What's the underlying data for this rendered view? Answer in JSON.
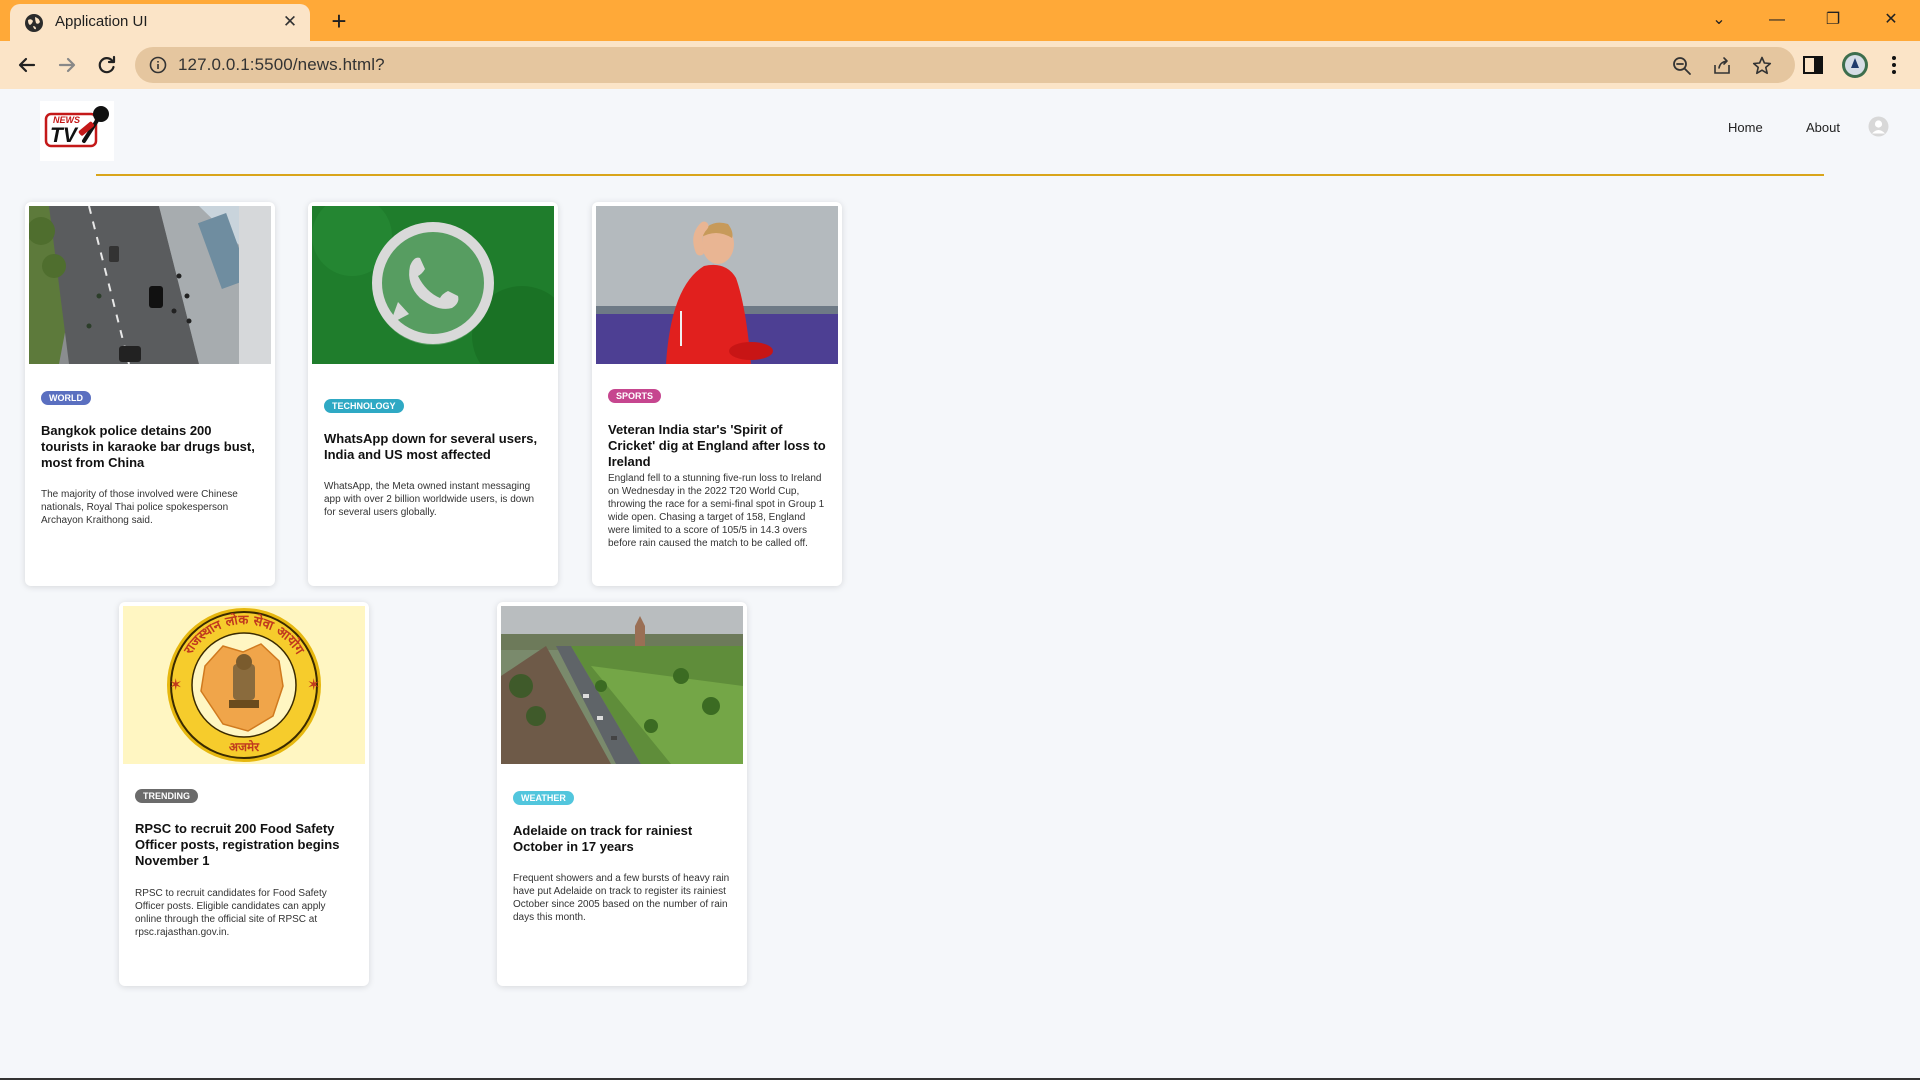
{
  "browser": {
    "tab_title": "Application UI",
    "url": "127.0.0.1:5500/news.html?",
    "accent_color": "#ffa938"
  },
  "header": {
    "logo_alt": "NEWS TV",
    "nav": [
      "Home",
      "About"
    ]
  },
  "articles": [
    {
      "category": "WORLD",
      "badge_color": "#5a6fc0",
      "title": "Bangkok police detains 200 tourists in karaoke bar drugs bust, most from China",
      "description": "The majority of those involved were Chinese nationals, Royal Thai police spokesperson Archayon Kraithong said.",
      "image": "street-scene-image"
    },
    {
      "category": "TECHNOLOGY",
      "badge_color": "#2fa9c4",
      "title": "WhatsApp down for several users, India and US most affected",
      "description": "WhatsApp, the Meta owned instant messaging app with over 2 billion worldwide users, is down for several users globally.",
      "image": "whatsapp-logo-image"
    },
    {
      "category": "SPORTS",
      "badge_color": "#c6468f",
      "title": "Veteran India star's 'Spirit of Cricket' dig at England after loss to Ireland",
      "description": "England fell to a stunning five-run loss to Ireland on Wednesday in the 2022 T20 World Cup, throwing the race for a semi-final spot in Group 1 wide open. Chasing a target of 158, England were limited to a score of 105/5 in 14.3 overs before rain caused the match to be called off.",
      "image": "cricketer-image"
    },
    {
      "category": "TRENDING",
      "badge_color": "#6b6b6b",
      "title": "RPSC to recruit 200 Food Safety Officer posts, registration begins November 1",
      "description": "RPSC to recruit candidates for Food Safety Officer posts. Eligible candidates can apply online through the official site of RPSC at rpsc.rajasthan.gov.in.",
      "image": "rpsc-seal-image",
      "seal_text_top": "राजस्थान लोक सेवा आयोग",
      "seal_text_bottom": "अजमेर"
    },
    {
      "category": "WEATHER",
      "badge_color": "#52c6dd",
      "title": "Adelaide on track for rainiest October in 17 years",
      "description": "Frequent showers and a few bursts of heavy rain have put Adelaide on track to register its rainiest October since 2005 based on the number of rain days this month.",
      "image": "adelaide-aerial-image"
    }
  ]
}
